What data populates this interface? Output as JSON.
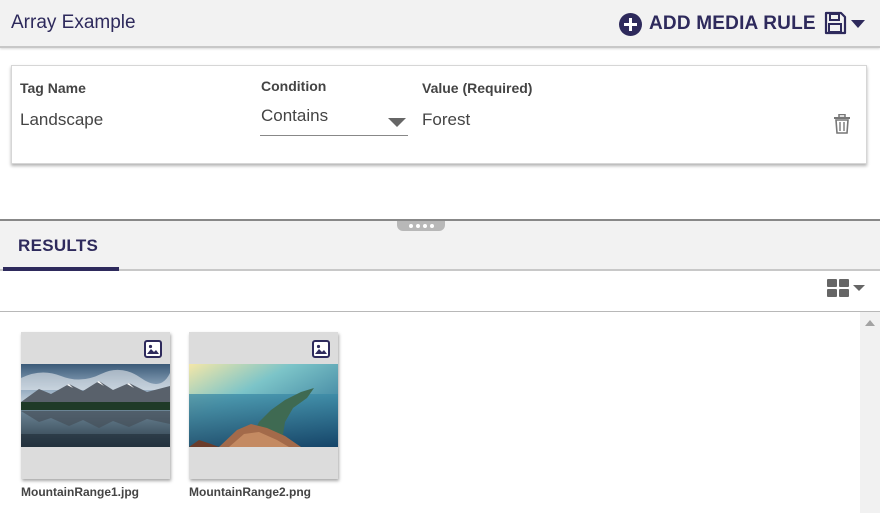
{
  "header": {
    "title": "Array Example",
    "add_rule_label": "ADD MEDIA RULE",
    "add_rule_icon": "plus-circle-icon",
    "save_icon": "floppy-disk-icon",
    "save_menu_icon": "caret-down-icon"
  },
  "rule": {
    "tag_name_label": "Tag Name",
    "tag_name_value": "Landscape",
    "condition_label": "Condition",
    "condition_value": "Contains",
    "value_label": "Value (Required)",
    "value_value": "Forest",
    "delete_icon": "trash-icon"
  },
  "results": {
    "tab_label": "RESULTS",
    "view_icon": "grid-view-icon",
    "items": [
      {
        "name": "MountainRange1.jpg",
        "type_icon": "image-icon"
      },
      {
        "name": "MountainRange2.png",
        "type_icon": "image-icon"
      }
    ]
  },
  "colors": {
    "accent": "#2e2a5c",
    "header_bg": "#f2f2f2",
    "card_bg": "#dcdcdc"
  }
}
